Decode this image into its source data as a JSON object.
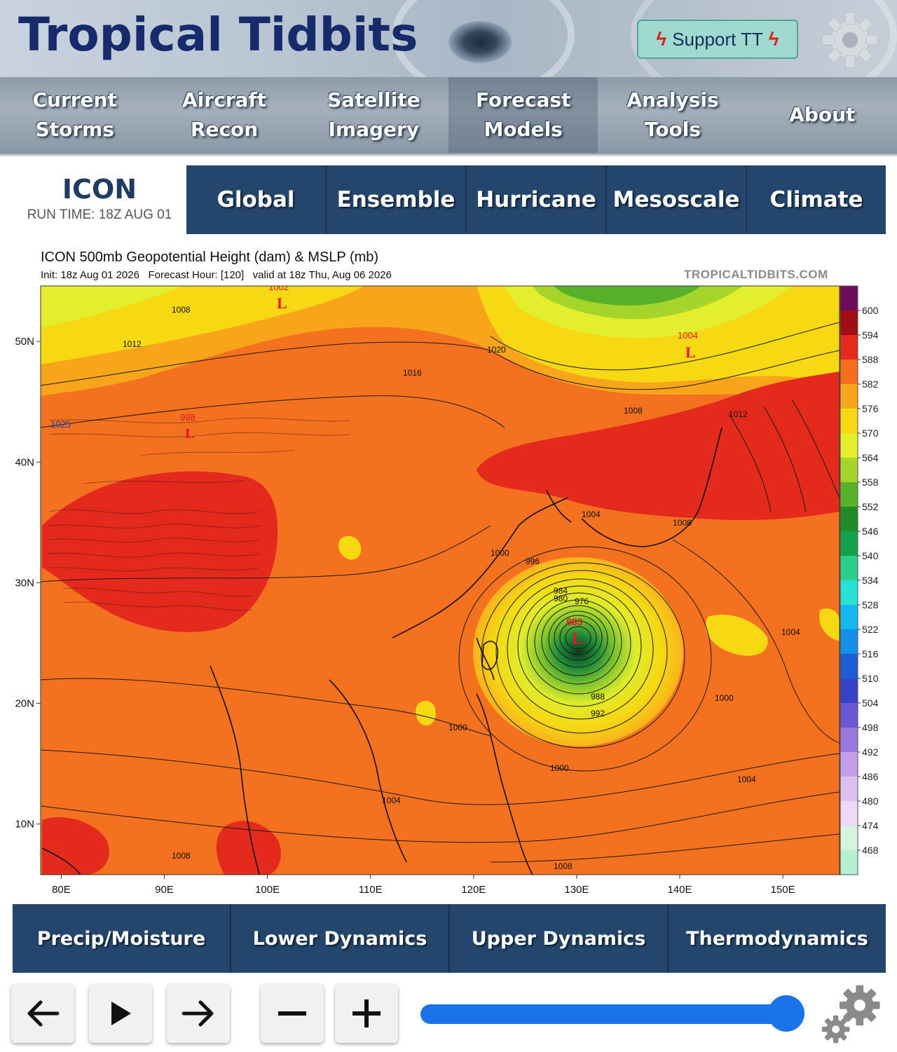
{
  "header": {
    "logo": "Tropical Tidbits",
    "support_button": "Support TT",
    "nav": [
      {
        "label": "Current\nStorms"
      },
      {
        "label": "Aircraft\nRecon"
      },
      {
        "label": "Satellite\nImagery"
      },
      {
        "label": "Forecast\nModels"
      },
      {
        "label": "Analysis\nTools"
      },
      {
        "label": "About"
      }
    ]
  },
  "model": {
    "name": "ICON",
    "run_time": "RUN TIME: 18Z AUG 01",
    "tabs": [
      "Global",
      "Ensemble",
      "Hurricane",
      "Mesoscale",
      "Climate"
    ]
  },
  "chart": {
    "title": "ICON 500mb Geopotential Height (dam) & MSLP (mb)",
    "subtitle": "Init: 18z Aug 01 2026   Forecast Hour: [120]   valid at 18z Thu, Aug 06 2026",
    "source": "TROPICALTIDBITS.COM"
  },
  "chart_data": {
    "type": "heatmap",
    "title": "ICON 500mb Geopotential Height (dam) & MSLP (mb)",
    "x_ticks": [
      "80E",
      "90E",
      "100E",
      "110E",
      "120E",
      "130E",
      "140E",
      "150E"
    ],
    "y_ticks": [
      "50N",
      "40N",
      "30N",
      "20N",
      "10N"
    ],
    "colorbar_ticks": [
      600,
      594,
      588,
      582,
      576,
      570,
      564,
      558,
      552,
      546,
      540,
      534,
      528,
      522,
      516,
      510,
      504,
      498,
      492,
      486,
      480,
      474,
      468
    ],
    "colorbar_colors": [
      "#6d0b5c",
      "#a10d14",
      "#e32a1c",
      "#f46e1c",
      "#f9a51c",
      "#f6d813",
      "#e3ef2c",
      "#a5d42a",
      "#57b22a",
      "#208a26",
      "#13a24a",
      "#2bcf8b",
      "#29e2d6",
      "#16b9ef",
      "#1490e8",
      "#1d5ed6",
      "#3842c6",
      "#6a55d2",
      "#9b78e0",
      "#c29ee8",
      "#ddc0f0",
      "#eed8f6",
      "#d6f3e0",
      "#b5eed0"
    ],
    "annotations": [
      {
        "text": "883",
        "kind": "pressure center"
      },
      {
        "text": "L",
        "kind": "low"
      },
      {
        "text": "1002",
        "kind": "pressure center"
      },
      {
        "text": "1004",
        "kind": "pressure center"
      },
      {
        "text": "1025",
        "kind": "pressure center"
      },
      {
        "text": "998",
        "kind": "pressure center"
      }
    ],
    "isobar_labels": [
      "1008",
      "1012",
      "1016",
      "1020",
      "1004",
      "1000",
      "996",
      "992",
      "988",
      "984",
      "980",
      "976"
    ]
  },
  "categories": [
    "Precip/Moisture",
    "Lower Dynamics",
    "Upper Dynamics",
    "Thermodynamics"
  ],
  "controls": {
    "prev_icon": "arrow-left-icon",
    "play_icon": "play-icon",
    "next_icon": "arrow-right-icon",
    "minus_icon": "minus-icon",
    "plus_icon": "plus-icon",
    "slider_value": 1.0,
    "accent": "#1a73e8"
  }
}
